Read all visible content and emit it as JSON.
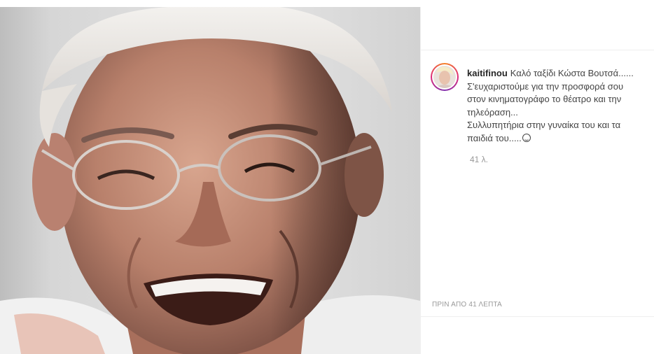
{
  "post": {
    "image": {
      "subject": "portrait-photo"
    },
    "author": {
      "username": "kaitifinou",
      "avatar_icon": "user-avatar"
    },
    "caption": {
      "lines": [
        "Καλό ταξίδι Κώστα Βουτσά......",
        "Σ'ευχαριστούμε για την προσφορά σου στον κινηματογράφο το θέατρο και την τηλεόραση...",
        "Συλλυπητήρια στην γυναίκα του και τα παιδιά του....."
      ],
      "end_emoji": "smiling-face-icon"
    },
    "comment_age": "41 λ.",
    "timestamp": "ΠΡΙΝ ΑΠΟ 41 ΛΕΠΤΑ"
  },
  "colors": {
    "divider": "#efefef",
    "meta_text": "#999999",
    "username": "#262626",
    "body_text": "#444444"
  }
}
